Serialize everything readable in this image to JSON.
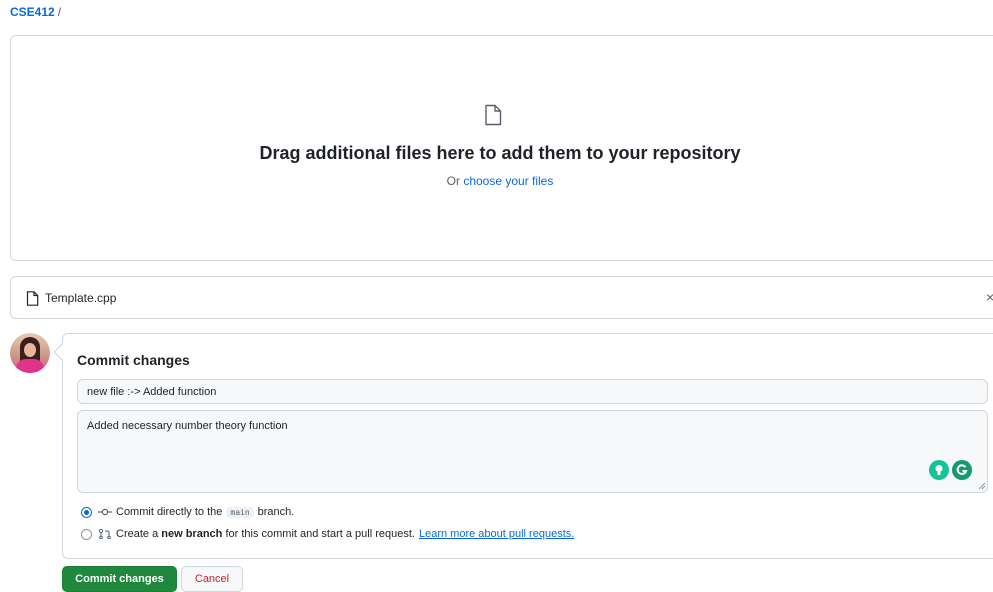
{
  "breadcrumb": {
    "repo": "CSE412",
    "separator": "/"
  },
  "dropzone": {
    "icon": "file-icon",
    "title": "Drag additional files here to add them to your repository",
    "or_text": "Or",
    "choose_link": "choose your files"
  },
  "file": {
    "icon": "file-icon",
    "name": "Template.cpp",
    "remove_label": "×"
  },
  "commit": {
    "heading": "Commit changes",
    "summary_value": "new file :-> Added function",
    "description_value": "Added necessary number theory function",
    "options": [
      {
        "checked": true,
        "icon": "git-commit-icon",
        "prefix": "Commit directly to the",
        "branch": "main",
        "suffix": "branch."
      },
      {
        "checked": false,
        "icon": "git-pull-request-icon",
        "prefix": "Create a",
        "bold": "new branch",
        "suffix": "for this commit and start a pull request.",
        "link": "Learn more about pull requests."
      }
    ]
  },
  "buttons": {
    "commit": "Commit changes",
    "cancel": "Cancel"
  },
  "colors": {
    "primary": "#1f883d",
    "link": "#0969da",
    "danger": "#cf222e",
    "border": "#d0d7de"
  }
}
